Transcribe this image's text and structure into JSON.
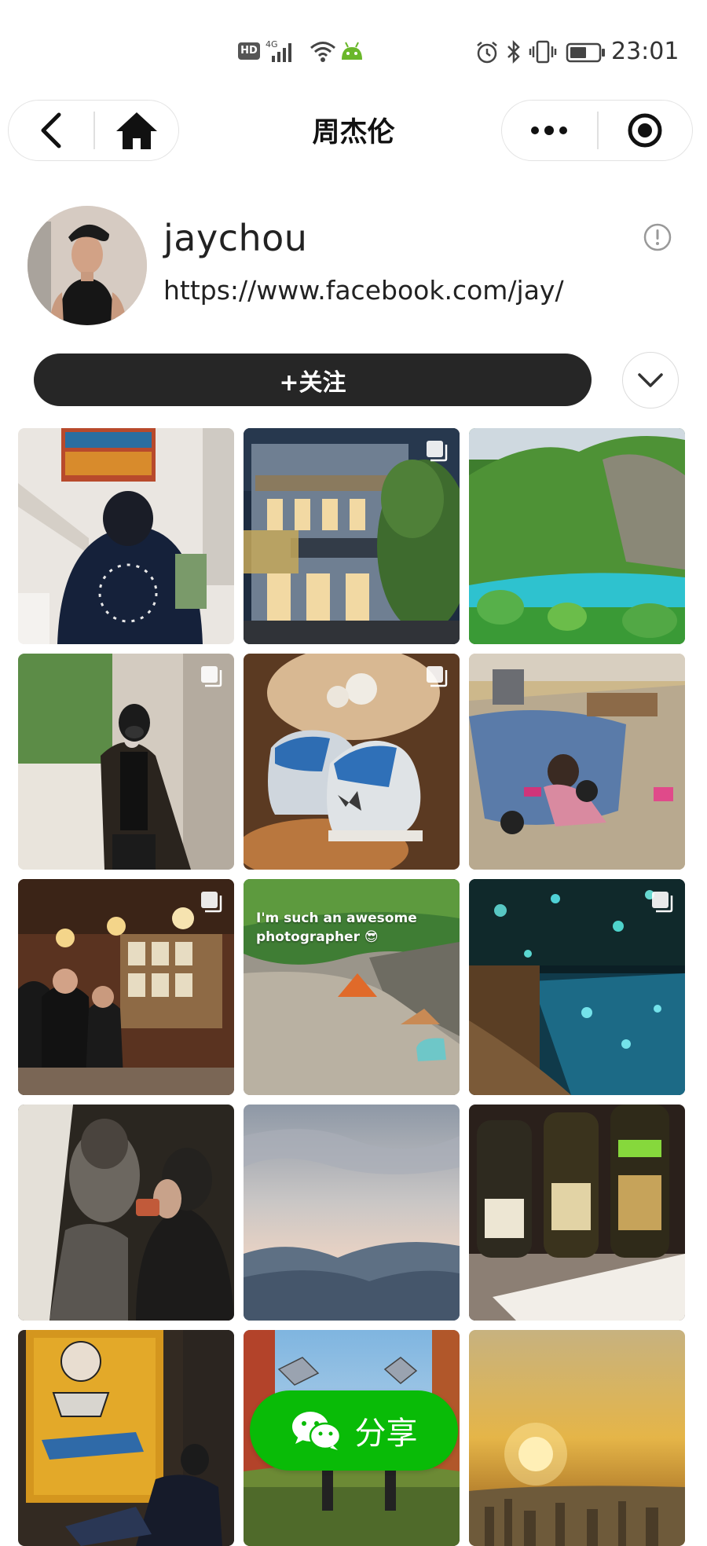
{
  "status_bar": {
    "hd_badge": "HD",
    "network": "4G",
    "time": "23:01",
    "icons": [
      "signal-icon",
      "wifi-icon",
      "android-icon",
      "alarm-icon",
      "bluetooth-icon",
      "vibrate-icon",
      "battery-icon"
    ]
  },
  "nav": {
    "title": "周杰伦",
    "back_icon": "chevron-left-icon",
    "home_icon": "home-icon",
    "more_icon": "ellipsis-icon",
    "close_icon": "target-icon"
  },
  "profile": {
    "username": "jaychou",
    "url": "https://www.facebook.com/jay/",
    "follow_label": "+关注",
    "more_icon": "chevron-down-icon",
    "info_icon": "info-icon"
  },
  "grid": {
    "tiles": [
      {
        "subject": "man in black cap in white room",
        "multi": false
      },
      {
        "subject": "gallery building facade at dusk",
        "multi": true
      },
      {
        "subject": "turquoise river in green mountains",
        "multi": false
      },
      {
        "subject": "man in black coat with mask",
        "multi": true
      },
      {
        "subject": "blue and white sneakers",
        "multi": true
      },
      {
        "subject": "child painting on floor",
        "multi": false
      },
      {
        "subject": "group of men in restaurant",
        "multi": true
      },
      {
        "subject": "campsite on riverbank",
        "multi": false,
        "caption": "I'm such an awesome photographer 😎"
      },
      {
        "subject": "glowing blue lake at night",
        "multi": true
      },
      {
        "subject": "people drinking at a bar",
        "multi": false
      },
      {
        "subject": "mountains under cloudy sky",
        "multi": false
      },
      {
        "subject": "three wine bottles",
        "multi": false
      },
      {
        "subject": "man sitting under basquiat painting",
        "multi": false
      },
      {
        "subject": "people with kites on grass",
        "multi": false
      },
      {
        "subject": "sunset over city",
        "multi": false
      }
    ]
  },
  "share": {
    "label": "分享",
    "icon": "wechat-icon",
    "color": "#09bb07"
  }
}
